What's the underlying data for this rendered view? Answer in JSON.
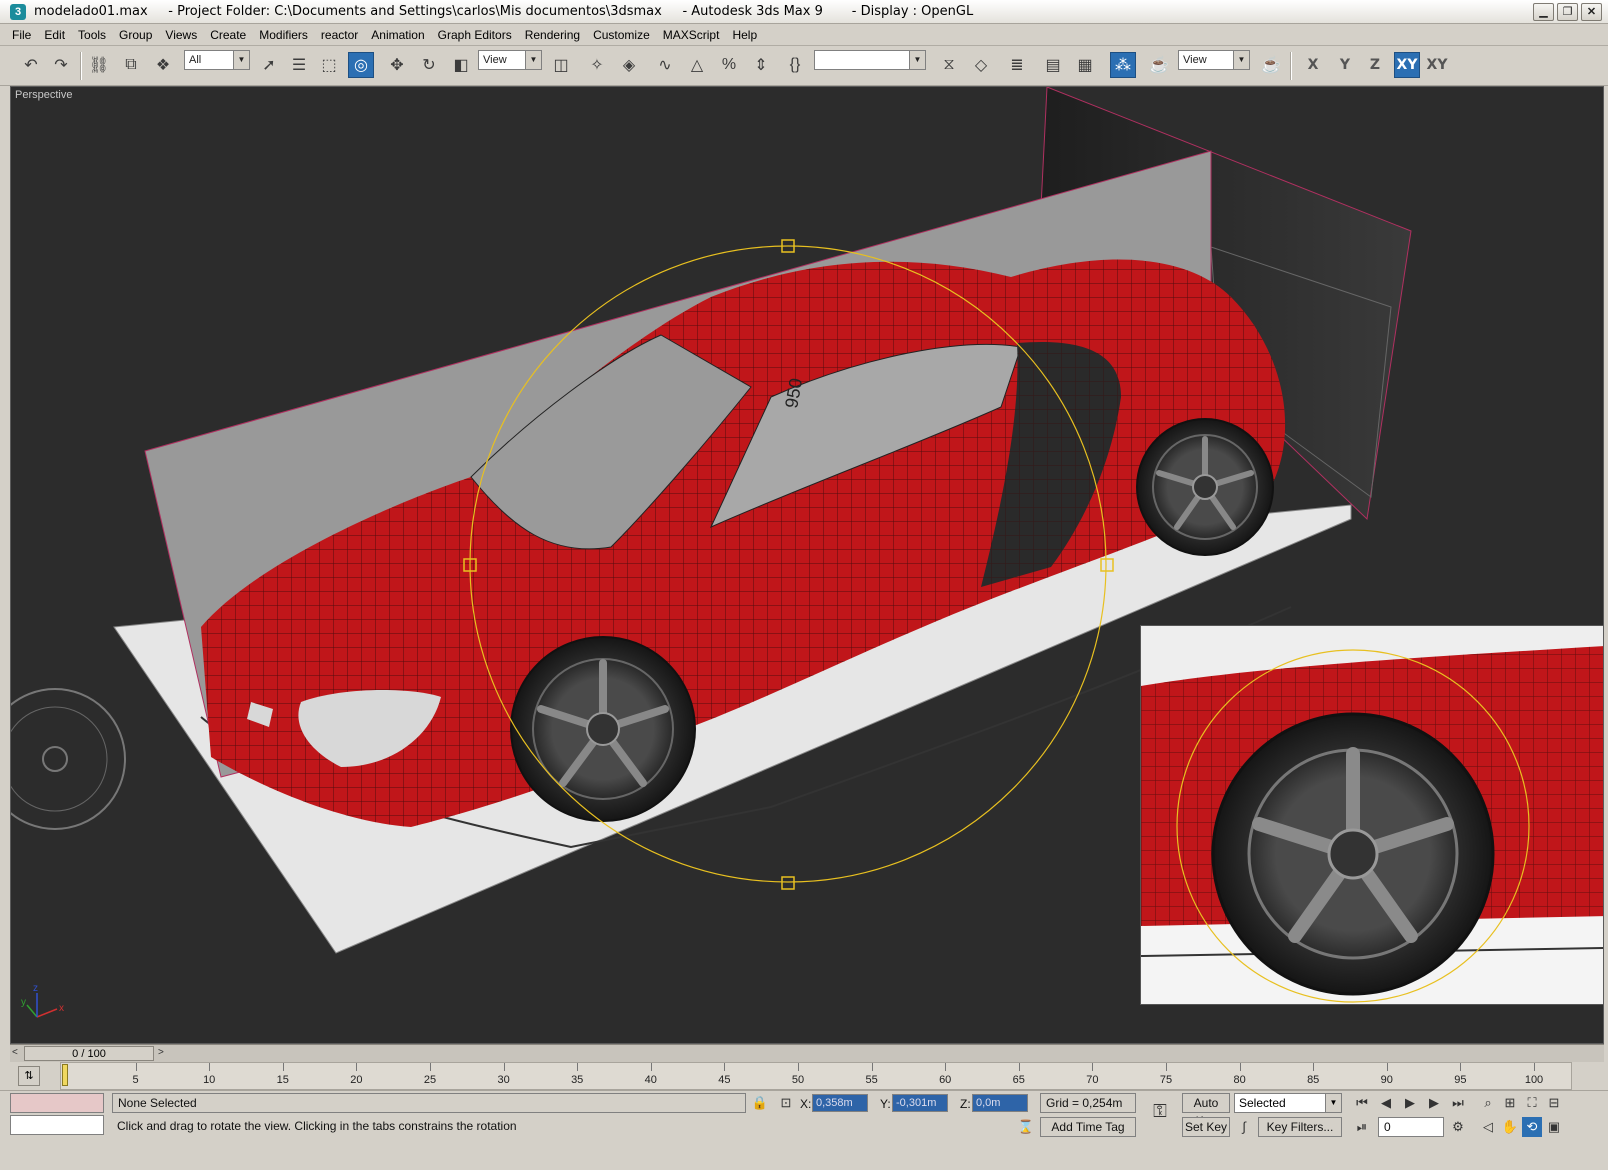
{
  "window": {
    "title": "modelado01.max     - Project Folder: C:\\Documents and Settings\\carlos\\Mis documentos\\3dsmax     - Autodesk 3ds Max 9       - Display : OpenGL",
    "minimize_icon": "minimize-icon",
    "maximize_icon": "restore-icon",
    "close_icon": "close-icon"
  },
  "menu": {
    "items": [
      "File",
      "Edit",
      "Tools",
      "Group",
      "Views",
      "Create",
      "Modifiers",
      "reactor",
      "Animation",
      "Graph Editors",
      "Rendering",
      "Customize",
      "MAXScript",
      "Help"
    ]
  },
  "toolbar": {
    "selection_filter": "All",
    "ref_coord_1": "View",
    "named_selection": "",
    "ref_coord_2": "View",
    "axis_buttons": [
      "X",
      "Y",
      "Z",
      "XY",
      "XY"
    ],
    "active_axis": "XY"
  },
  "viewport": {
    "label": "Perspective",
    "axis_labels": [
      "x",
      "y",
      "z"
    ],
    "dimension_mark": "950"
  },
  "timeslider": {
    "position": "0 / 100",
    "left_arrow": "<",
    "right_arrow": ">"
  },
  "trackbar": {
    "ticks": [
      "5",
      "10",
      "15",
      "20",
      "25",
      "30",
      "35",
      "40",
      "45",
      "50",
      "55",
      "60",
      "65",
      "70",
      "75",
      "80",
      "85",
      "90",
      "95",
      "100"
    ]
  },
  "status": {
    "selection_status": "None Selected",
    "prompt": "Click and drag to rotate the view.  Clicking in the tabs constrains the rotation",
    "x_label": "X:",
    "x_value": "0,358m",
    "y_label": "Y:",
    "y_value": "-0,301m",
    "z_label": "Z:",
    "z_value": "0,0m",
    "grid": "Grid = 0,254m",
    "add_time_tag": "Add Time Tag",
    "auto_key": "Auto Key",
    "set_key": "Set Key",
    "key_mode": "Selected",
    "key_filters": "Key Filters...",
    "current_frame": "0"
  },
  "colors": {
    "viewport_bg": "#2c2c2c",
    "car_red": "#c0161a",
    "selection_gizmo": "#e8c020",
    "ui_face": "#d4d0c8",
    "active_button": "#2b6fb3"
  }
}
